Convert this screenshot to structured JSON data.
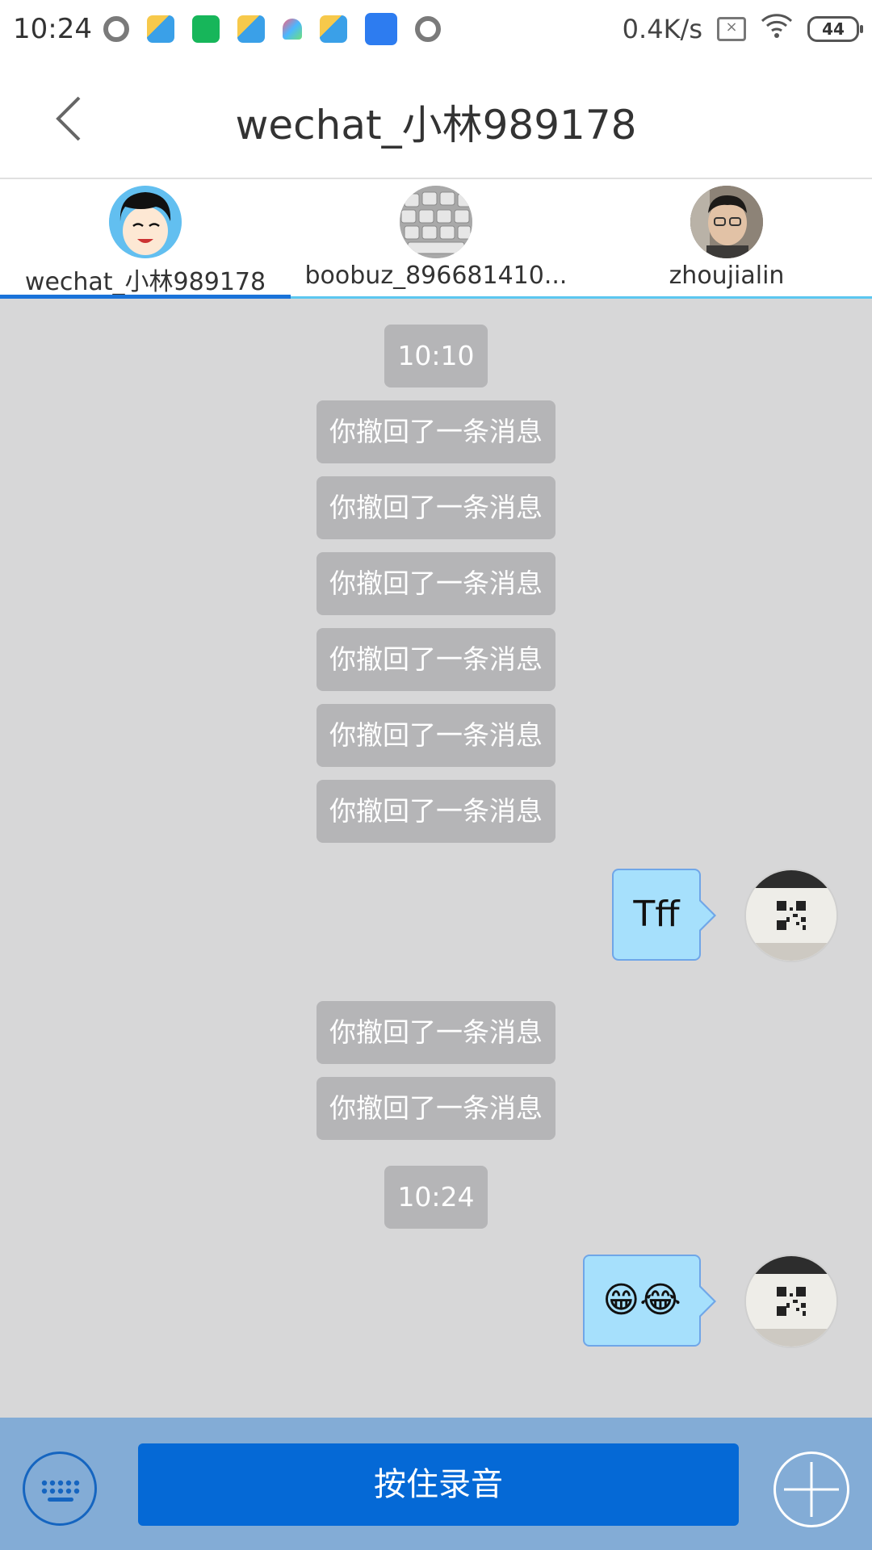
{
  "status_bar": {
    "time": "10:24",
    "net_speed": "0.4K/s",
    "battery": "44",
    "icons": [
      "record-icon",
      "paper-plane-icon",
      "green-app-icon",
      "paper-plane-icon",
      "color-a-icon",
      "paper-plane-icon",
      "blue-app-icon",
      "record-icon",
      "sim-icon",
      "wifi-icon",
      "battery-icon"
    ]
  },
  "header": {
    "title": "wechat_小林989178"
  },
  "tabs": [
    {
      "label": "wechat_小林989178",
      "active": true
    },
    {
      "label": "boobuz_896681410...",
      "active": false
    },
    {
      "label": "zhoujialin",
      "active": false
    }
  ],
  "messages": {
    "time1": "10:10",
    "recalled": [
      "你撤回了一条消息",
      "你撤回了一条消息",
      "你撤回了一条消息",
      "你撤回了一条消息",
      "你撤回了一条消息",
      "你撤回了一条消息",
      "你撤回了一条消息",
      "你撤回了一条消息"
    ],
    "outgoing1": "Tff",
    "time2": "10:24",
    "outgoing2": "😁😂"
  },
  "bottom_bar": {
    "record_label": "按住录音"
  },
  "colors": {
    "accent": "#1a73d9",
    "chat_bg": "#d7d7d8",
    "bubble": "#a6e0fc",
    "record_button": "#0569d6",
    "bottom_bar": "#83acd6"
  }
}
